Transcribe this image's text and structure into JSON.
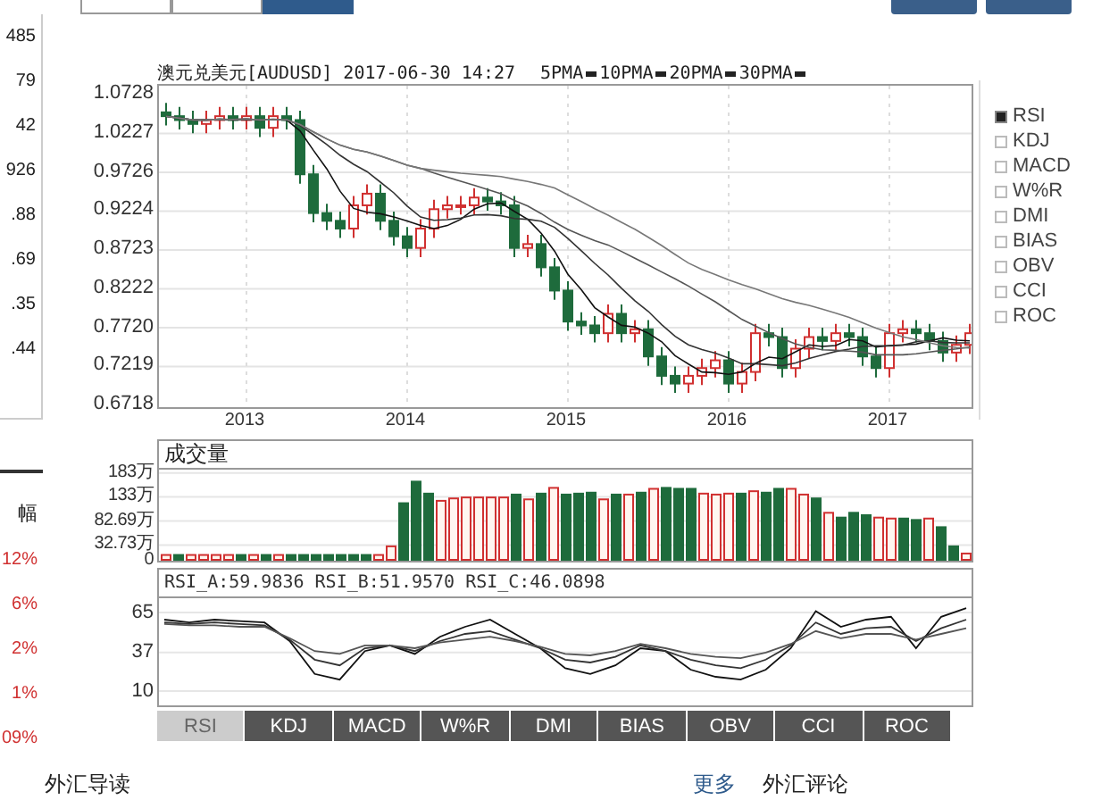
{
  "top_tabs": [
    {
      "selected": false
    },
    {
      "selected": false
    },
    {
      "selected": true
    }
  ],
  "top_buttons": [
    {
      "kind": "button"
    },
    {
      "kind": "button"
    }
  ],
  "left_column": {
    "values": [
      "485",
      "79",
      "42",
      "926",
      ".88",
      ".69",
      ".35",
      ".44"
    ],
    "header": "幅",
    "changes": [
      "12%",
      "6%",
      "2%",
      "1%",
      "09%"
    ]
  },
  "chart": {
    "title": "澳元兑美元[AUDUSD] 2017-06-30 14:27",
    "ma_legend": [
      {
        "label": "5PMA"
      },
      {
        "label": "10PMA"
      },
      {
        "label": "20PMA"
      },
      {
        "label": "30PMA"
      }
    ],
    "price_labels": [
      "1.0728",
      "1.0227",
      "0.9726",
      "0.9224",
      "0.8723",
      "0.8222",
      "0.7720",
      "0.7219",
      "0.6718"
    ],
    "year_labels": [
      "2013",
      "2014",
      "2015",
      "2016",
      "2017"
    ]
  },
  "indicators": [
    {
      "label": "RSI",
      "checked": true
    },
    {
      "label": "KDJ",
      "checked": false
    },
    {
      "label": "MACD",
      "checked": false
    },
    {
      "label": "W%R",
      "checked": false
    },
    {
      "label": "DMI",
      "checked": false
    },
    {
      "label": "BIAS",
      "checked": false
    },
    {
      "label": "OBV",
      "checked": false
    },
    {
      "label": "CCI",
      "checked": false
    },
    {
      "label": "ROC",
      "checked": false
    }
  ],
  "volume": {
    "title": "成交量",
    "chart_data": {
      "type": "bar",
      "grid": true,
      "ylim": [
        0,
        190
      ],
      "yticks": [
        {
          "value": 183,
          "label": "183万"
        },
        {
          "value": 133,
          "label": "133万"
        },
        {
          "value": 82.69,
          "label": "82.69万"
        },
        {
          "value": 32.73,
          "label": "32.73万"
        },
        {
          "value": 0,
          "label": "0"
        }
      ],
      "series": [
        {
          "color": "#d03030",
          "values": [
            12,
            null,
            12,
            12,
            12,
            12,
            null,
            12,
            null,
            12,
            null,
            null,
            null,
            null,
            null,
            null,
            null,
            12,
            30,
            null,
            null,
            null,
            125,
            130,
            132,
            132,
            132,
            132,
            null,
            128,
            null,
            152,
            null,
            null,
            null,
            128,
            null,
            138,
            null,
            150,
            null,
            null,
            null,
            140,
            138,
            140,
            null,
            145,
            null,
            null,
            150,
            138,
            null,
            100,
            null,
            null,
            null,
            90,
            88,
            null,
            null,
            88,
            null,
            null,
            15
          ]
        },
        {
          "color": "#1e6b3c",
          "values": [
            null,
            12,
            null,
            null,
            null,
            null,
            12,
            null,
            12,
            null,
            12,
            12,
            12,
            12,
            12,
            12,
            12,
            null,
            null,
            120,
            165,
            140,
            null,
            null,
            null,
            null,
            null,
            null,
            138,
            null,
            140,
            null,
            138,
            140,
            142,
            null,
            138,
            null,
            142,
            null,
            152,
            150,
            150,
            null,
            null,
            null,
            140,
            null,
            142,
            150,
            null,
            null,
            130,
            null,
            90,
            100,
            95,
            null,
            null,
            88,
            85,
            null,
            70,
            30,
            null
          ]
        }
      ]
    }
  },
  "rsi": {
    "readings": [
      "RSI_A:59.9836",
      "RSI_B:51.9570",
      "RSI_C:46.0898"
    ],
    "chart_data": {
      "type": "line",
      "grid": true,
      "ylim": [
        0,
        75
      ],
      "yticks": [
        {
          "value": 65,
          "label": "65"
        },
        {
          "value": 37,
          "label": "37"
        },
        {
          "value": 10,
          "label": "10"
        }
      ],
      "series": [
        {
          "color": "#111111",
          "values": [
            60,
            58,
            60,
            59,
            58,
            45,
            22,
            18,
            38,
            42,
            36,
            48,
            55,
            60,
            50,
            40,
            26,
            22,
            28,
            40,
            38,
            25,
            20,
            18,
            25,
            40,
            66,
            55,
            60,
            62,
            40,
            62,
            68
          ]
        },
        {
          "color": "#333333",
          "values": [
            58,
            57,
            58,
            57,
            56,
            46,
            32,
            28,
            40,
            42,
            38,
            45,
            50,
            52,
            46,
            40,
            32,
            30,
            34,
            42,
            38,
            32,
            28,
            26,
            32,
            42,
            58,
            50,
            54,
            55,
            45,
            54,
            60
          ]
        },
        {
          "color": "#555555",
          "values": [
            57,
            56,
            56,
            55,
            55,
            47,
            38,
            36,
            42,
            42,
            40,
            44,
            46,
            48,
            45,
            41,
            36,
            35,
            38,
            43,
            40,
            36,
            34,
            33,
            37,
            43,
            52,
            47,
            50,
            50,
            46,
            50,
            54
          ]
        }
      ]
    }
  },
  "indicator_tabs": [
    {
      "label": "RSI",
      "selected": true
    },
    {
      "label": "KDJ",
      "selected": false
    },
    {
      "label": "MACD",
      "selected": false
    },
    {
      "label": "W%R",
      "selected": false
    },
    {
      "label": "DMI",
      "selected": false
    },
    {
      "label": "BIAS",
      "selected": false
    },
    {
      "label": "OBV",
      "selected": false
    },
    {
      "label": "CCI",
      "selected": false
    },
    {
      "label": "ROC",
      "selected": false
    }
  ],
  "footer": {
    "left": "外汇导读",
    "more": "更多",
    "right": "外汇评论"
  }
}
